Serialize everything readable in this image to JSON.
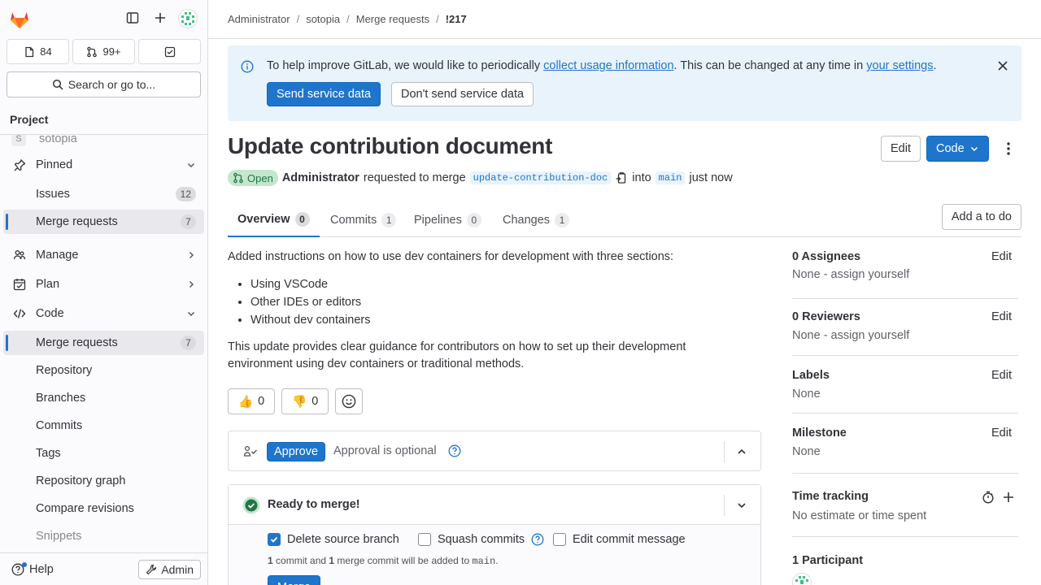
{
  "sidebar": {
    "counts": {
      "issues": "84",
      "merge_requests": "99+"
    },
    "search_label": "Search or go to...",
    "project_header": "Project",
    "project_name": "sotopia",
    "project_initial": "S",
    "items": [
      {
        "label": "Pinned"
      },
      {
        "label": "Issues",
        "badge": "12"
      },
      {
        "label": "Merge requests",
        "badge": "7"
      },
      {
        "label": "Manage"
      },
      {
        "label": "Plan"
      },
      {
        "label": "Code"
      },
      {
        "label": "Merge requests",
        "badge": "7"
      },
      {
        "label": "Repository"
      },
      {
        "label": "Branches"
      },
      {
        "label": "Commits"
      },
      {
        "label": "Tags"
      },
      {
        "label": "Repository graph"
      },
      {
        "label": "Compare revisions"
      },
      {
        "label": "Snippets"
      }
    ],
    "help_label": "Help",
    "admin_label": "Admin"
  },
  "breadcrumb": [
    "Administrator",
    "sotopia",
    "Merge requests",
    "!217"
  ],
  "banner": {
    "text_before": "To help improve GitLab, we would like to periodically ",
    "link1": "collect usage information",
    "text_middle": ". This can be changed at any time in ",
    "link2": "your settings",
    "text_after": ".",
    "send_label": "Send service data",
    "dont_send_label": "Don't send service data"
  },
  "mr": {
    "title": "Update contribution document",
    "edit_label": "Edit",
    "code_label": "Code",
    "status": "Open",
    "author": "Administrator",
    "requested_text": "requested to merge",
    "source_branch": "update-contribution-doc",
    "into_text": "into",
    "target_branch": "main",
    "time_text": "just now"
  },
  "tabs": [
    {
      "label": "Overview",
      "count": "0"
    },
    {
      "label": "Commits",
      "count": "1"
    },
    {
      "label": "Pipelines",
      "count": "0"
    },
    {
      "label": "Changes",
      "count": "1"
    }
  ],
  "todo_label": "Add a to do",
  "description": {
    "intro": "Added instructions on how to use dev containers for development with three sections:",
    "bullets": [
      "Using VSCode",
      "Other IDEs or editors",
      "Without dev containers"
    ],
    "outro": "This update provides clear guidance for contributors on how to set up their development environment using dev containers or traditional methods."
  },
  "reactions": {
    "thumbsup": "👍",
    "thumbsup_count": "0",
    "thumbsdown": "👎",
    "thumbsdown_count": "0"
  },
  "approval": {
    "approve_label": "Approve",
    "optional_text": "Approval is optional"
  },
  "merge": {
    "ready_text": "Ready to merge!",
    "delete_branch": "Delete source branch",
    "squash": "Squash commits",
    "edit_message": "Edit commit message",
    "note_count1": "1",
    "note_text1": " commit and ",
    "note_count2": "1",
    "note_text2": " merge commit will be added to ",
    "note_branch": "main",
    "note_end": ".",
    "merge_label": "Merge"
  },
  "side": {
    "assignees_title": "0 Assignees",
    "assignees_value": "None - assign yourself",
    "reviewers_title": "0 Reviewers",
    "reviewers_value": "None - assign yourself",
    "labels_title": "Labels",
    "labels_value": "None",
    "milestone_title": "Milestone",
    "milestone_value": "None",
    "time_title": "Time tracking",
    "time_value": "No estimate or time spent",
    "participants_title": "1 Participant",
    "edit_label": "Edit"
  },
  "colors": {
    "accent": "#1f75cb",
    "success": "#217645",
    "sidebar_bg": "#fbfafd"
  }
}
